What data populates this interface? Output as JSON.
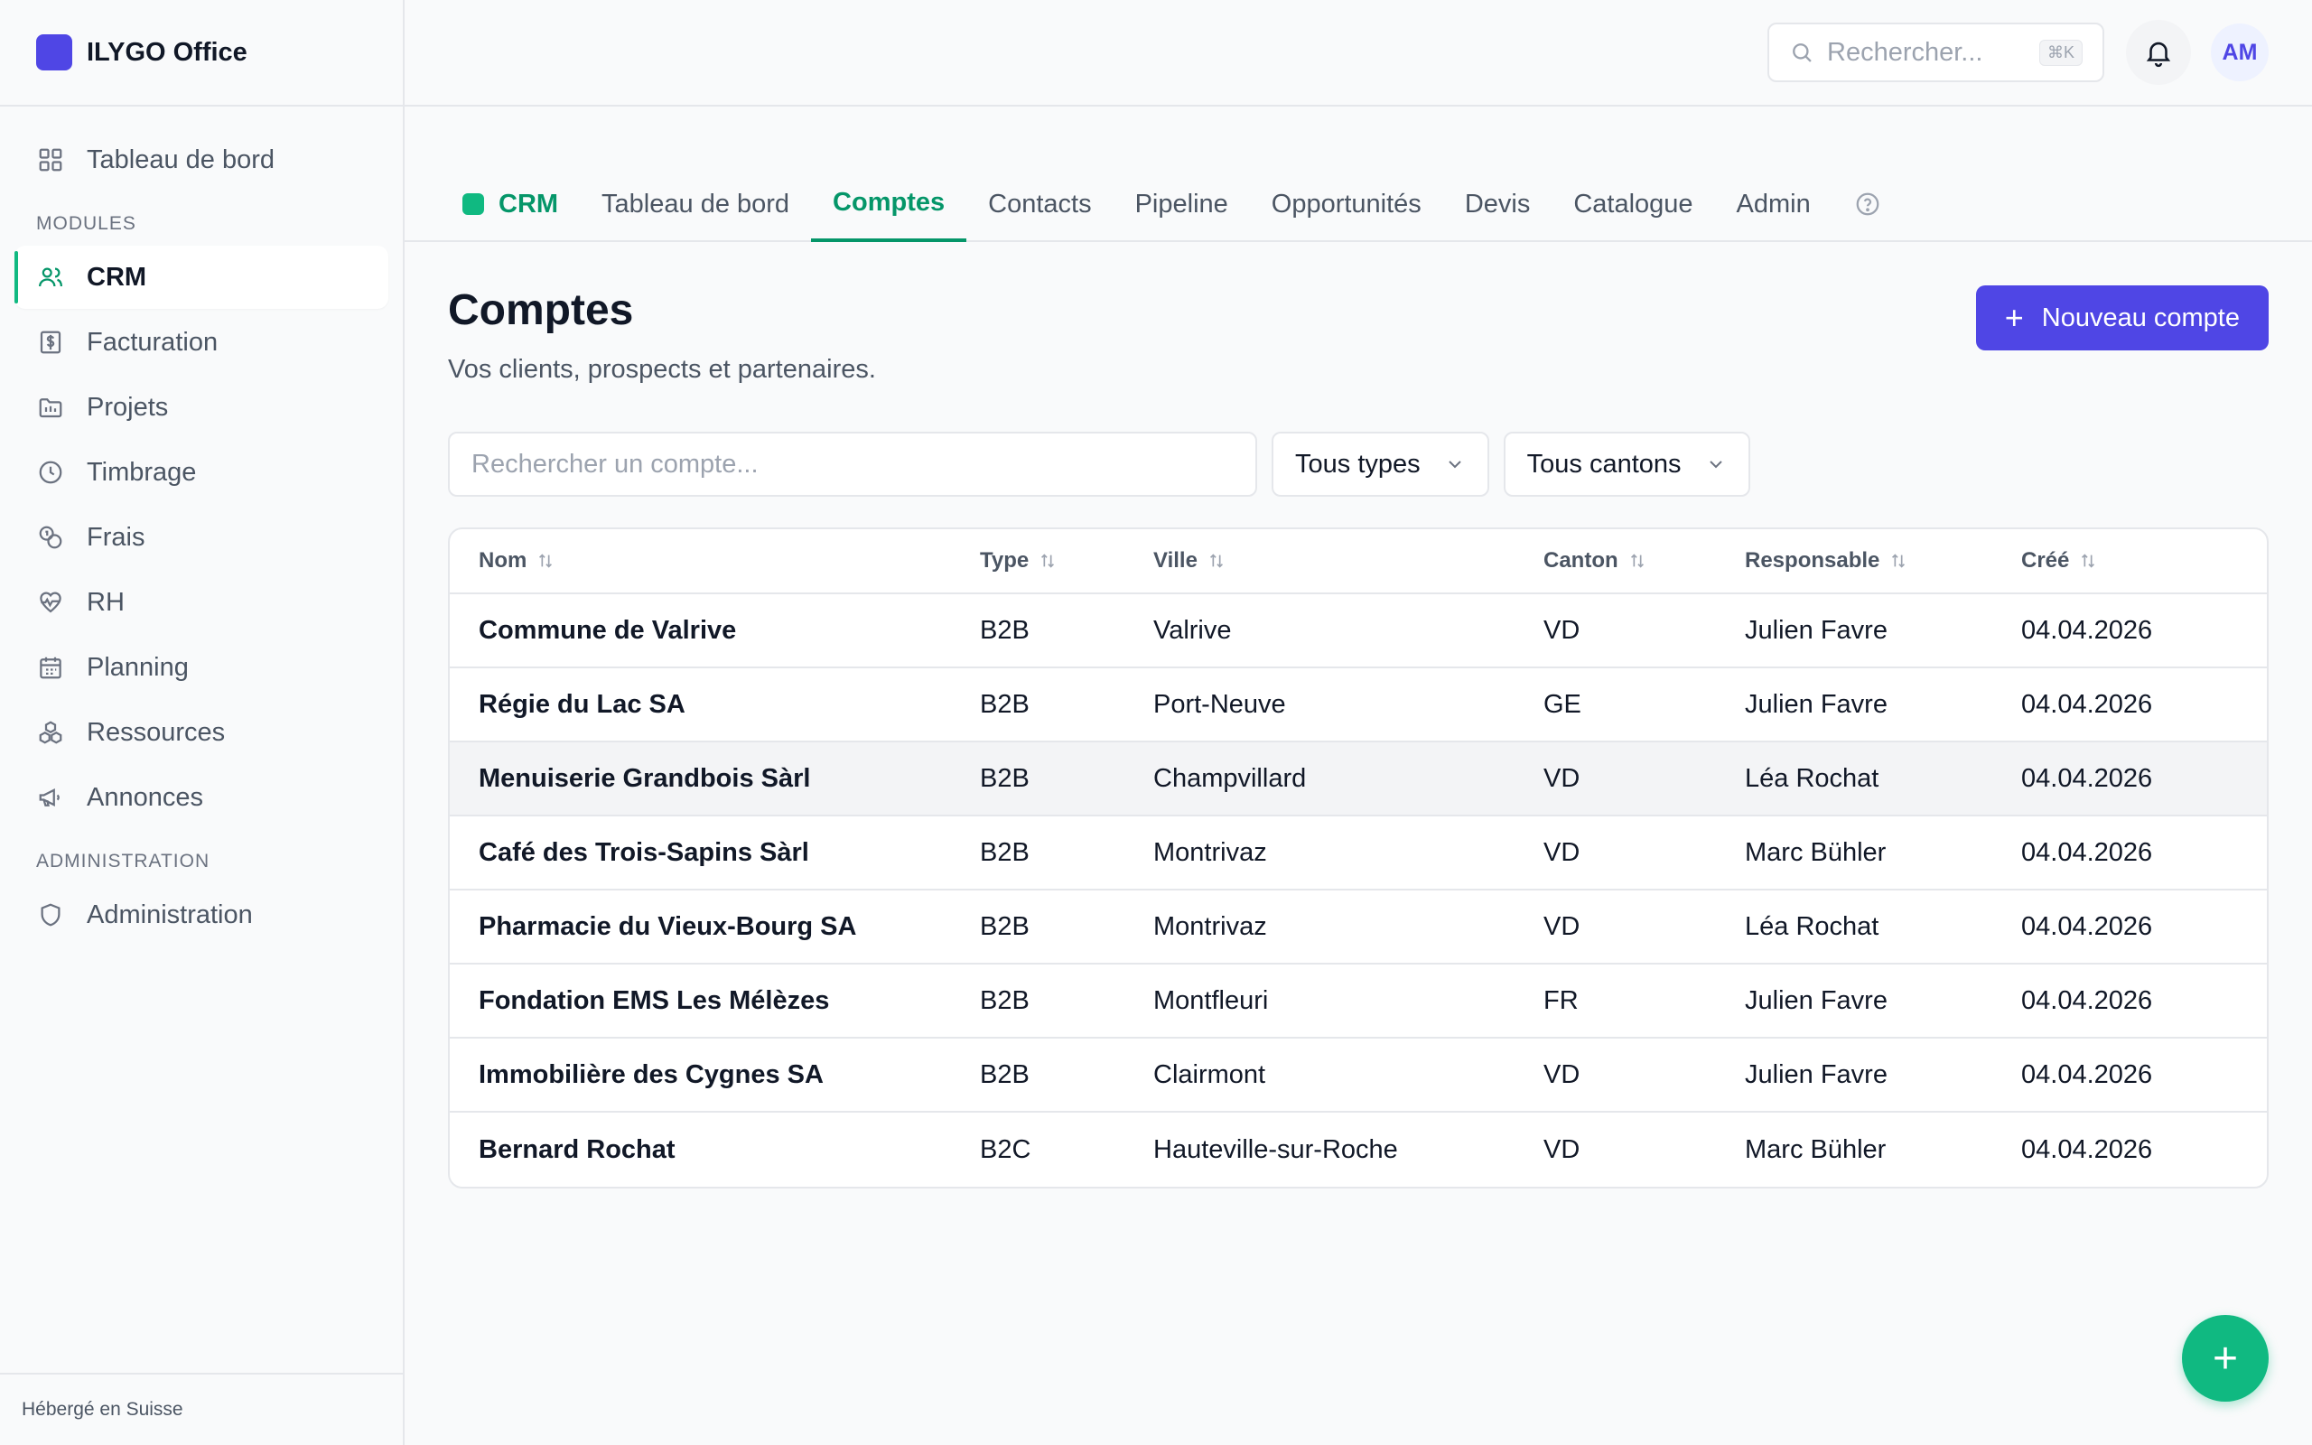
{
  "brand": {
    "name": "ILYGO Office"
  },
  "sidebar": {
    "top_item": {
      "label": "Tableau de bord",
      "icon": "dashboard-grid-icon"
    },
    "modules_label": "MODULES",
    "items": [
      {
        "label": "CRM",
        "icon": "users-icon",
        "active": true
      },
      {
        "label": "Facturation",
        "icon": "invoice-icon"
      },
      {
        "label": "Projets",
        "icon": "folder-icon"
      },
      {
        "label": "Timbrage",
        "icon": "clock-icon"
      },
      {
        "label": "Frais",
        "icon": "coins-icon"
      },
      {
        "label": "RH",
        "icon": "heart-pulse-icon"
      },
      {
        "label": "Planning",
        "icon": "calendar-icon"
      },
      {
        "label": "Ressources",
        "icon": "boxes-icon"
      },
      {
        "label": "Annonces",
        "icon": "megaphone-icon"
      }
    ],
    "admin_label": "ADMINISTRATION",
    "admin_item": {
      "label": "Administration",
      "icon": "shield-icon"
    },
    "footer": "Hébergé en Suisse"
  },
  "topbar": {
    "search_placeholder": "Rechercher...",
    "shortcut": "⌘K",
    "avatar_initials": "AM"
  },
  "tabs": {
    "module": "CRM",
    "items": [
      "Tableau de bord",
      "Comptes",
      "Contacts",
      "Pipeline",
      "Opportunités",
      "Devis",
      "Catalogue",
      "Admin"
    ],
    "active": "Comptes"
  },
  "page": {
    "title": "Comptes",
    "subtitle": "Vos clients, prospects et partenaires.",
    "new_button": "Nouveau compte"
  },
  "filters": {
    "search_placeholder": "Rechercher un compte...",
    "type_select": "Tous types",
    "canton_select": "Tous cantons"
  },
  "table": {
    "columns": [
      "Nom",
      "Type",
      "Ville",
      "Canton",
      "Responsable",
      "Créé"
    ],
    "rows": [
      [
        "Commune de Valrive",
        "B2B",
        "Valrive",
        "VD",
        "Julien Favre",
        "04.04.2026"
      ],
      [
        "Régie du Lac SA",
        "B2B",
        "Port-Neuve",
        "GE",
        "Julien Favre",
        "04.04.2026"
      ],
      [
        "Menuiserie Grandbois Sàrl",
        "B2B",
        "Champvillard",
        "VD",
        "Léa Rochat",
        "04.04.2026"
      ],
      [
        "Café des Trois-Sapins Sàrl",
        "B2B",
        "Montrivaz",
        "VD",
        "Marc Bühler",
        "04.04.2026"
      ],
      [
        "Pharmacie du Vieux-Bourg SA",
        "B2B",
        "Montrivaz",
        "VD",
        "Léa Rochat",
        "04.04.2026"
      ],
      [
        "Fondation EMS Les Mélèzes",
        "B2B",
        "Montfleuri",
        "FR",
        "Julien Favre",
        "04.04.2026"
      ],
      [
        "Immobilière des Cygnes SA",
        "B2B",
        "Clairmont",
        "VD",
        "Julien Favre",
        "04.04.2026"
      ],
      [
        "Bernard Rochat",
        "B2C",
        "Hauteville-sur-Roche",
        "VD",
        "Marc Bühler",
        "04.04.2026"
      ]
    ],
    "highlighted_row": 2
  },
  "colors": {
    "accent": "#4f46e5",
    "crm_green": "#059669",
    "fab": "#10b981"
  }
}
